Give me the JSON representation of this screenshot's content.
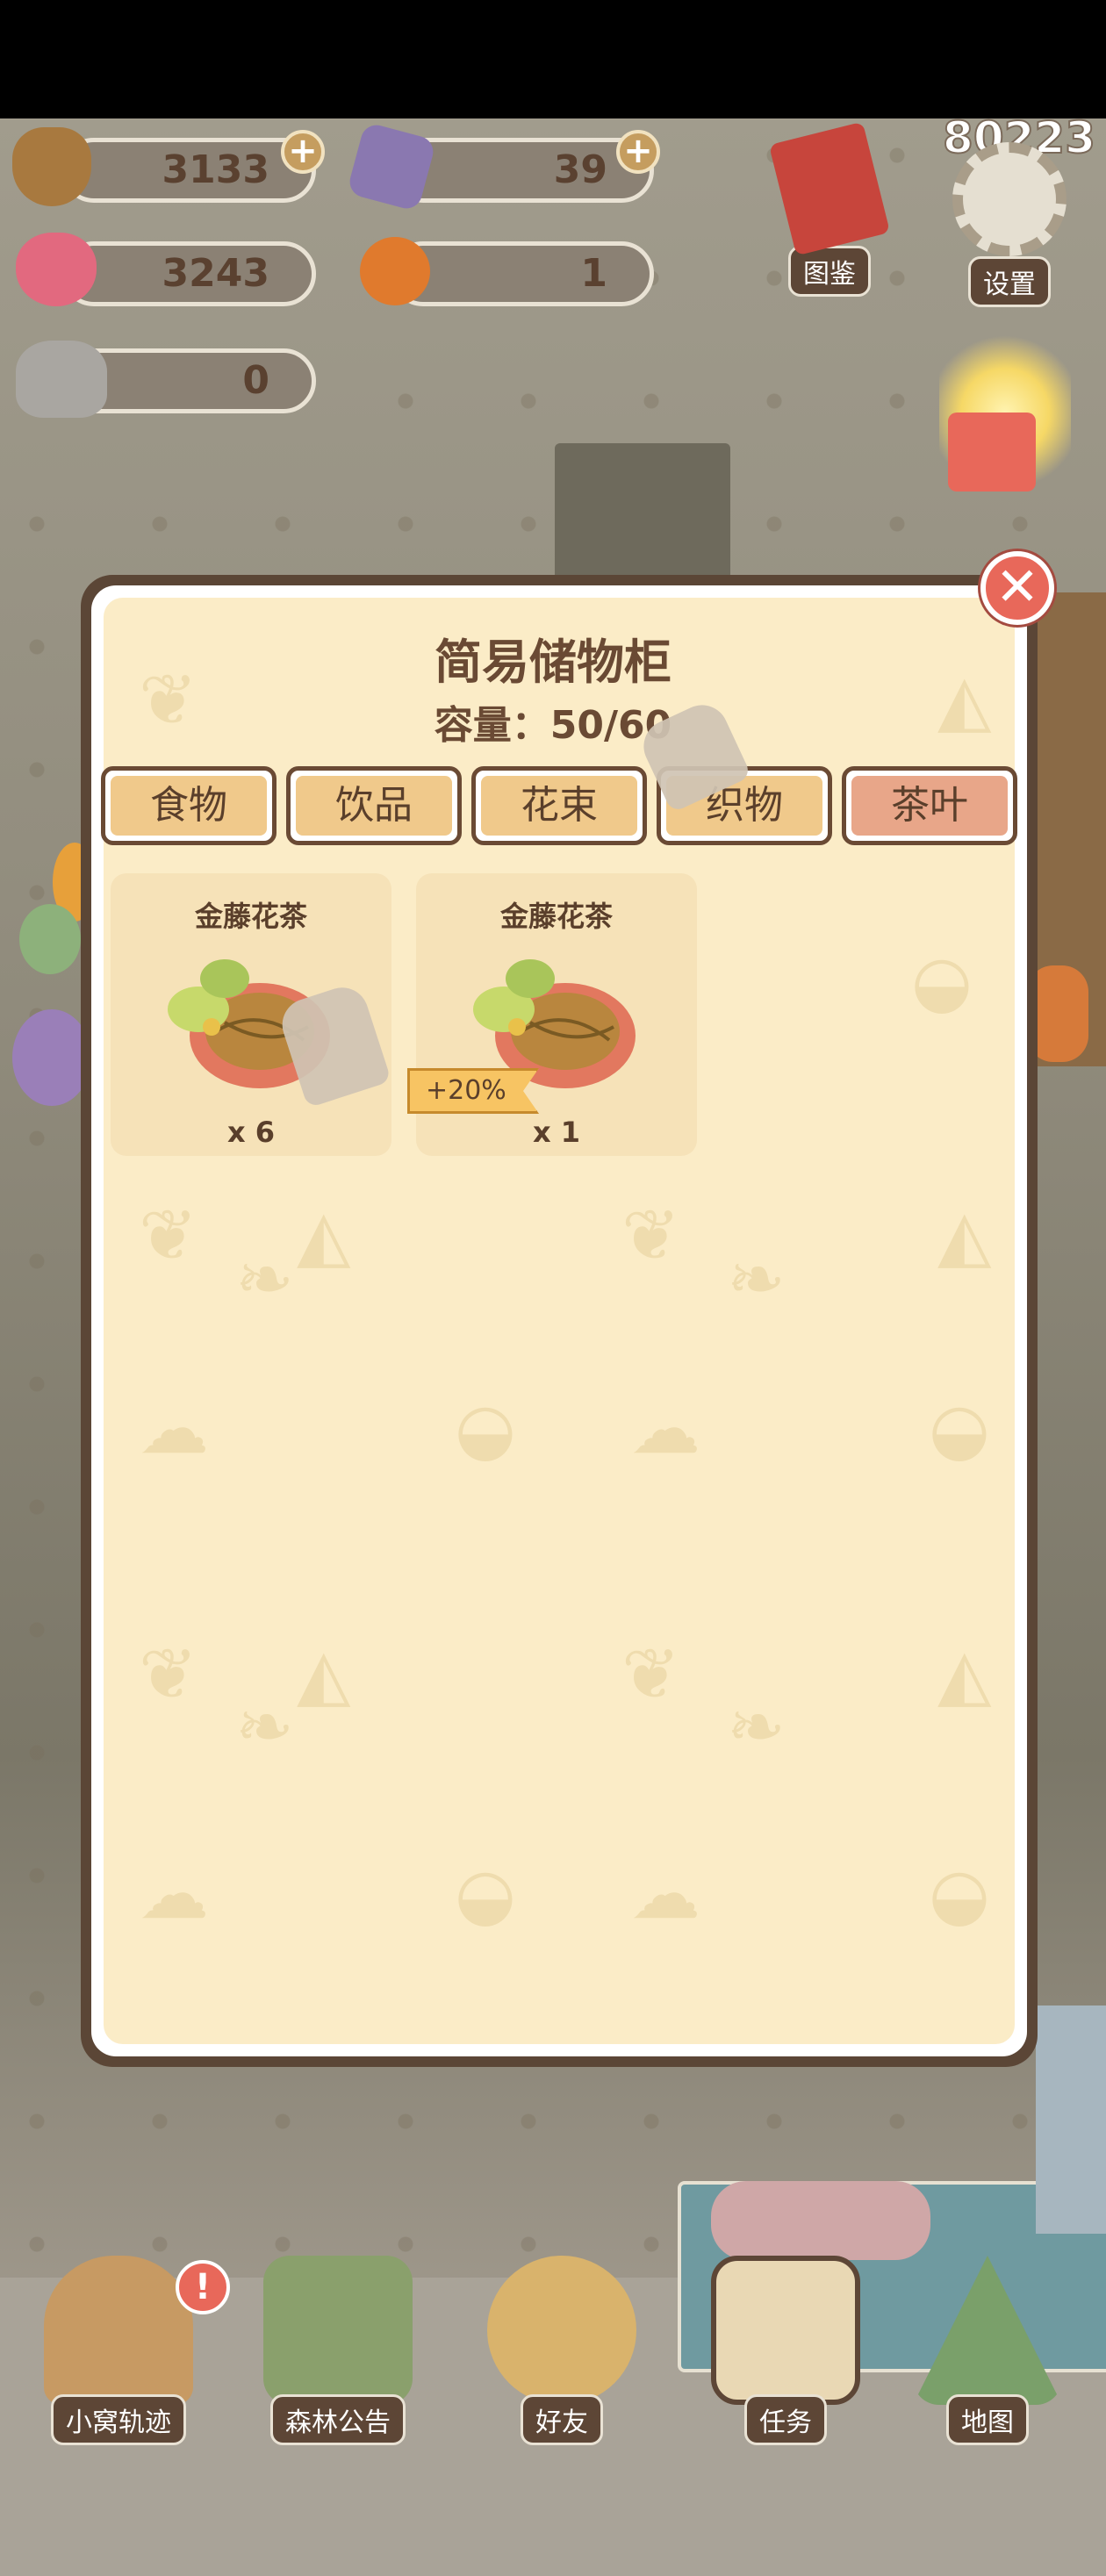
{
  "resources": {
    "acorns": {
      "value": "3133",
      "icon": "acorn-icon"
    },
    "gems": {
      "value": "39",
      "icon": "gem-icon"
    },
    "hearts": {
      "value": "3243",
      "icon": "heart-gem-icon"
    },
    "pumpkins": {
      "value": "1",
      "icon": "pumpkin-icon"
    },
    "robot": {
      "value": "0",
      "icon": "robot-icon"
    }
  },
  "score": "80223",
  "top_right": {
    "collection_label": "图鉴",
    "settings_label": "设置"
  },
  "dialog": {
    "title": "简易储物柜",
    "capacity": "容量：50/60",
    "tabs": [
      {
        "label": "食物",
        "active": false
      },
      {
        "label": "饮品",
        "active": false
      },
      {
        "label": "花束",
        "active": false
      },
      {
        "label": "织物",
        "active": false
      },
      {
        "label": "茶叶",
        "active": true
      }
    ],
    "items": [
      {
        "name": "金藤花茶",
        "qty": "x 6",
        "bonus": ""
      },
      {
        "name": "金藤花茶",
        "qty": "x 1",
        "bonus": "+20%"
      }
    ]
  },
  "bottom_nav": [
    {
      "label": "小窝轨迹",
      "icon": "house-icon"
    },
    {
      "label": "森林公告",
      "icon": "mail-icon"
    },
    {
      "label": "好友",
      "icon": "friends-icon"
    },
    {
      "label": "任务",
      "icon": "clipboard-icon"
    },
    {
      "label": "地图",
      "icon": "map-icon"
    }
  ],
  "colors": {
    "panel_bg": "#fbecc7",
    "panel_border": "#5b4636",
    "tab_default": "#f0c98b",
    "tab_active": "#e8a689",
    "close": "#e8685a"
  }
}
